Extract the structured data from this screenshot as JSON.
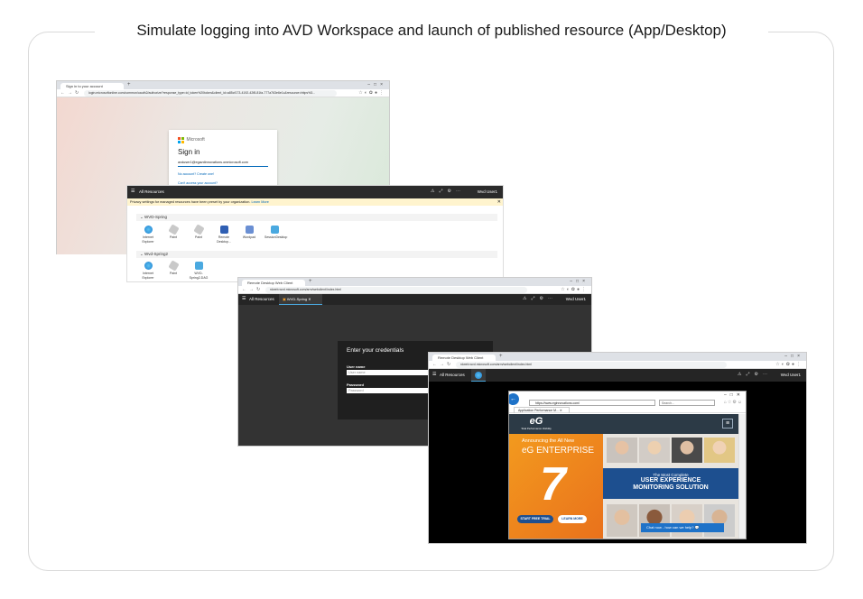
{
  "title": "Simulate logging into AVD Workspace and launch of published resource (App/Desktop)",
  "signin": {
    "tab": "Sign in to your account",
    "url": "login.microsoftonline.com/common/oauth2/authorize?response_type=id_token%20token&client_id=a85cf173-4192-42f8-81fa-777a763e6e1c&resource=https%3...",
    "brand": "Microsoft",
    "heading": "Sign in",
    "email": "avduser1@egavdinnovations.onmicrosoft.com",
    "no_account": "No account? Create one!",
    "cant_access": "Can't access your account?"
  },
  "feed": {
    "bar_label": "All Resources",
    "user": "Wvd User1",
    "notice": "Privacy settings for managed resources have been preset by your organization.",
    "notice_link": "Learn More",
    "group1": {
      "name": "WVD-Spring",
      "apps": [
        "Internet Explorer",
        "Paint",
        "Paint",
        "Remote Desktop...",
        "Wordpad",
        "SessionDesktop"
      ]
    },
    "group2": {
      "name": "Wvd-Spring2",
      "apps": [
        "Internet Explorer",
        "Paint",
        "WVD-Spring2-DAG"
      ]
    }
  },
  "creds": {
    "tab": "Remote Desktop Web Client",
    "url": "rdweb.wvd.microsoft.com/arm/webclient/index.html",
    "bar_label": "All Resources",
    "session_tab": "WVD-Spring",
    "user": "Wvd User1",
    "heading": "Enter your credentials",
    "user_label": "User name",
    "user_placeholder": "User name",
    "pass_label": "Password",
    "pass_placeholder": "Password"
  },
  "session": {
    "tab": "Remote Desktop Web Client",
    "url": "rdweb.wvd.microsoft.com/arm/webclient/index.html",
    "bar_label": "All Resources",
    "user": "Wvd User1",
    "ie_url": "https://www.eginnovations.com/",
    "ie_search": "Search...",
    "ie_tab": "Application Performance M...",
    "banner_announce": "Announcing the All New",
    "banner_product": "eG ENTERPRISE",
    "logo_tagline": "Total Performance Visibility",
    "mid_line1": "The Most Complete",
    "mid_line2": "USER EXPERIENCE",
    "mid_line3": "MONITORING SOLUTION",
    "btn_trial": "START FREE TRIAL",
    "btn_learn": "LEARN MORE",
    "chat": "Chat now - how can we help?",
    "logo": "eG",
    "seven": "7"
  }
}
